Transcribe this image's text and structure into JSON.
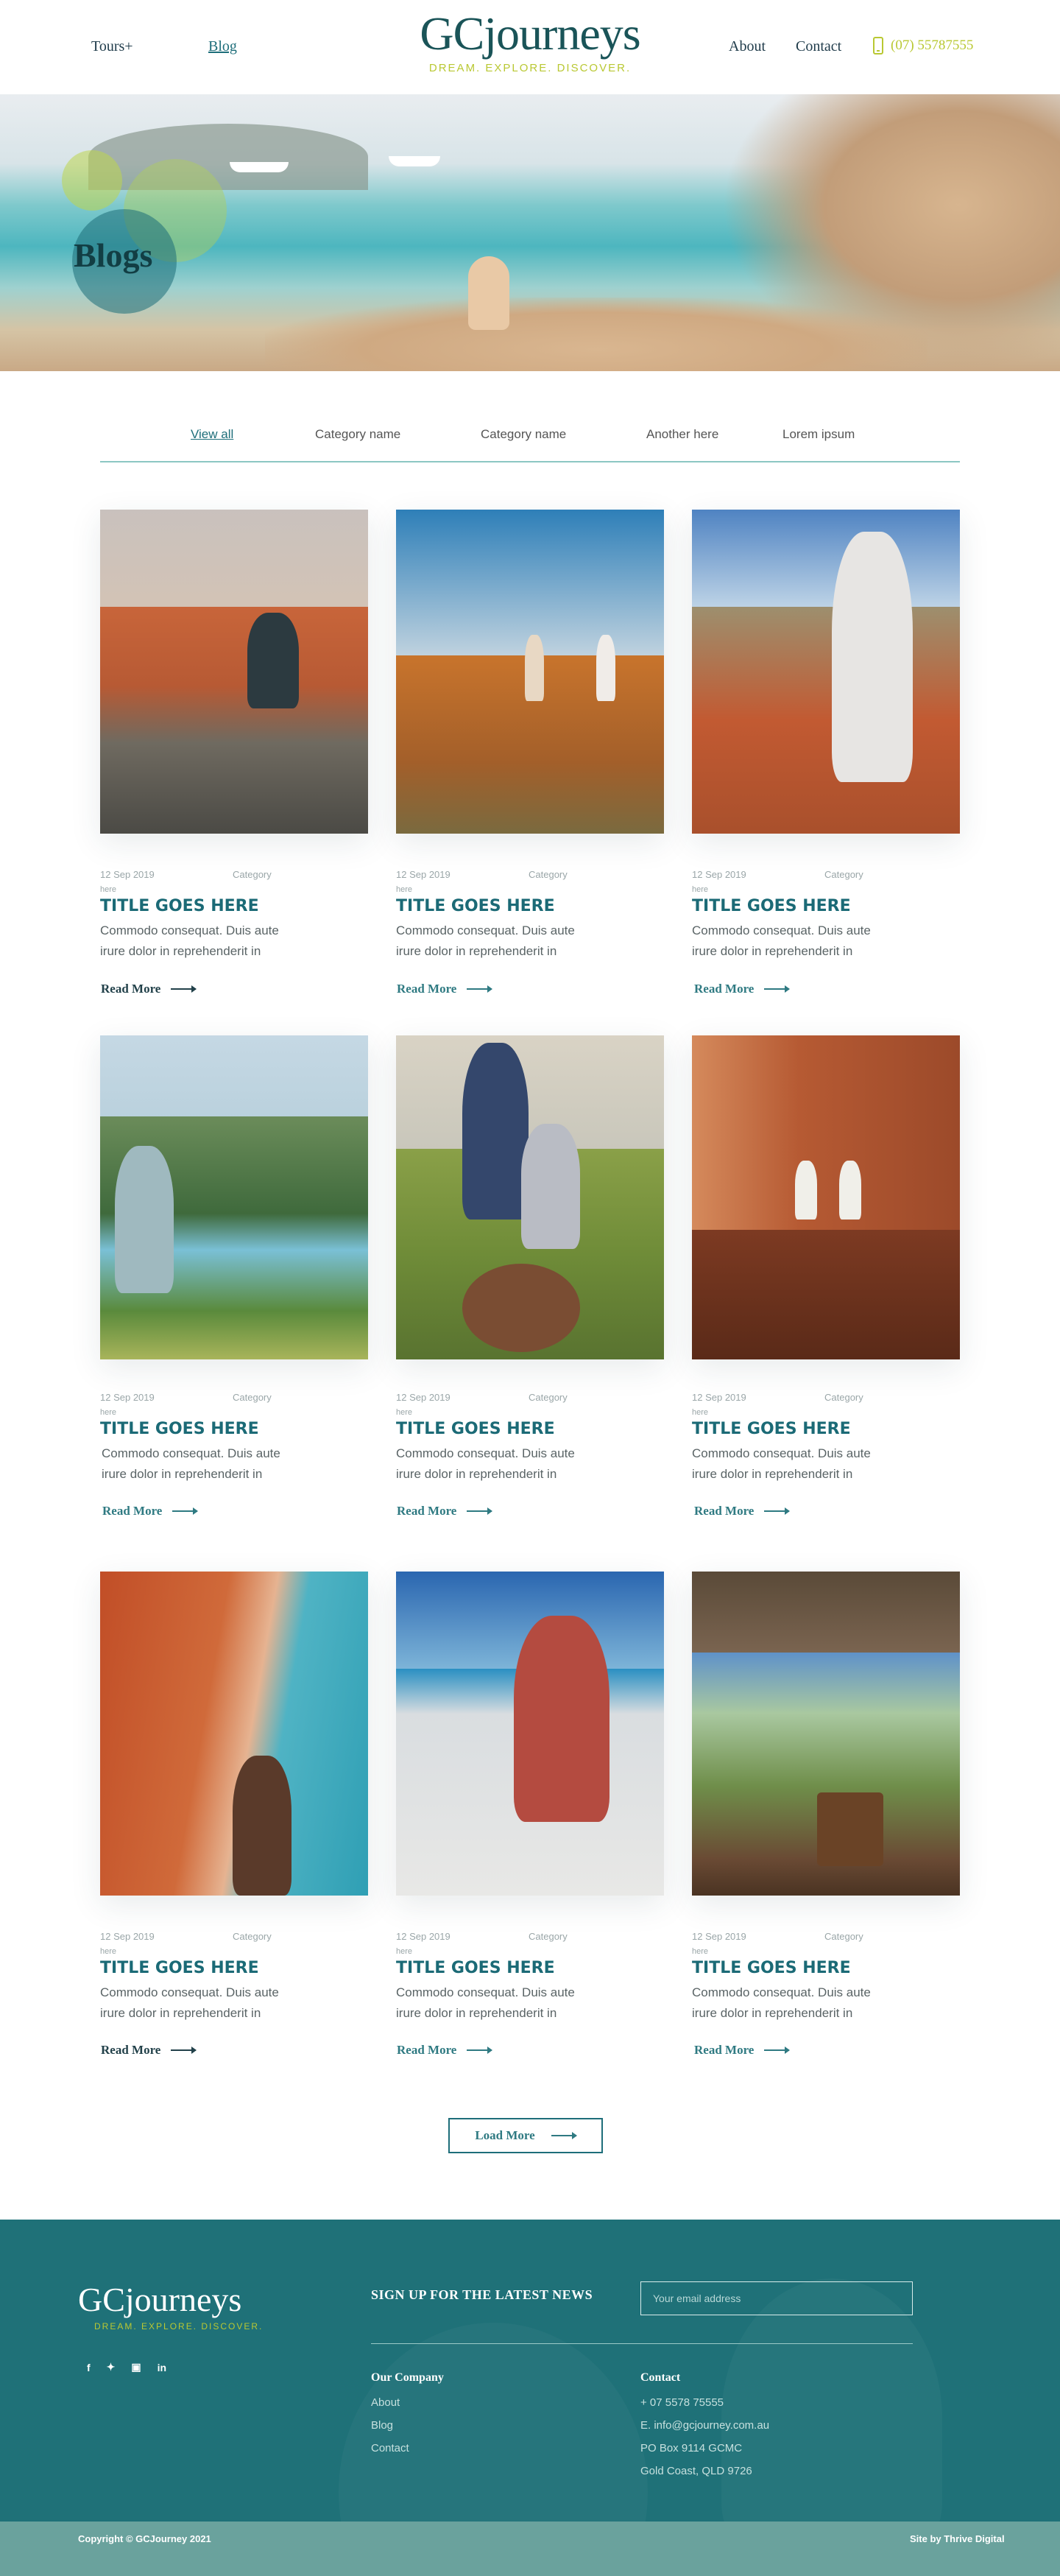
{
  "header": {
    "nav_left": [
      "Tours+",
      "Blog"
    ],
    "logo_main": "GCjourneys",
    "logo_tagline": "DREAM. EXPLORE. DISCOVER.",
    "nav_right": [
      "About",
      "Contact"
    ],
    "phone": "(07) 55787555",
    "colors": {
      "accent": "#b9c832",
      "primary": "#1a5458",
      "link_active": "#1e6e7a"
    }
  },
  "hero": {
    "title": "Blogs"
  },
  "filters": [
    "View all",
    "Category name",
    "Category name",
    "Another here",
    "Lorem ipsum"
  ],
  "cards": [
    {
      "date": "12 Sep 2019",
      "category": "Category",
      "here": "here",
      "title": "TITLE GOES HERE",
      "excerpt": "Commodo consequat. Duis aute irure dolor in reprehenderit in",
      "read_more": "Read More"
    },
    {
      "date": "12 Sep 2019",
      "category": "Category",
      "here": "here",
      "title": "TITLE GOES HERE",
      "excerpt": "Commodo consequat. Duis aute irure dolor in reprehenderit in",
      "read_more": "Read More"
    },
    {
      "date": "12 Sep 2019",
      "category": "Category",
      "here": "here",
      "title": "TITLE GOES HERE",
      "excerpt": "Commodo consequat. Duis aute irure dolor in reprehenderit in",
      "read_more": "Read More"
    },
    {
      "date": "12 Sep 2019",
      "category": "Category",
      "here": "here",
      "title": "TITLE GOES HERE",
      "excerpt": "Commodo consequat. Duis aute irure dolor in reprehenderit in",
      "read_more": "Read More"
    },
    {
      "date": "12 Sep 2019",
      "category": "Category",
      "here": "here",
      "title": "TITLE GOES HERE",
      "excerpt": "Commodo consequat. Duis aute irure dolor in reprehenderit in",
      "read_more": "Read More"
    },
    {
      "date": "12 Sep 2019",
      "category": "Category",
      "here": "here",
      "title": "TITLE GOES HERE",
      "excerpt": "Commodo consequat. Duis aute irure dolor in reprehenderit in",
      "read_more": "Read More"
    },
    {
      "date": "12 Sep 2019",
      "category": "Category",
      "here": "here",
      "title": "TITLE GOES HERE",
      "excerpt": "Commodo consequat. Duis aute irure dolor in reprehenderit in",
      "read_more": "Read More"
    },
    {
      "date": "12 Sep 2019",
      "category": "Category",
      "here": "here",
      "title": "TITLE GOES HERE",
      "excerpt": "Commodo consequat. Duis aute irure dolor in reprehenderit in",
      "read_more": "Read More"
    },
    {
      "date": "12 Sep 2019",
      "category": "Category",
      "here": "here",
      "title": "TITLE GOES HERE",
      "excerpt": "Commodo consequat. Duis aute irure dolor in reprehenderit in",
      "read_more": "Read More"
    }
  ],
  "load_more": "Load More",
  "footer": {
    "logo_main": "GCjourneys",
    "logo_tagline": "DREAM. EXPLORE. DISCOVER.",
    "socials": [
      "facebook-icon",
      "twitter-icon",
      "instagram-icon",
      "linkedin-icon"
    ],
    "signup_title": "SIGN UP FOR THE LATEST NEWS",
    "email_placeholder": "Your email address",
    "company_title": "Our Company",
    "company_links": [
      "About",
      "Blog",
      "Contact"
    ],
    "contact_title": "Contact",
    "contact_lines": [
      "+ 07 5578 75555",
      "E. info@gcjourney.com.au",
      "PO Box 9114 GCMC",
      "Gold Coast, QLD 9726"
    ],
    "copyright": "Copyright © GCJourney 2021",
    "site_by": "Site by Thrive Digital"
  }
}
